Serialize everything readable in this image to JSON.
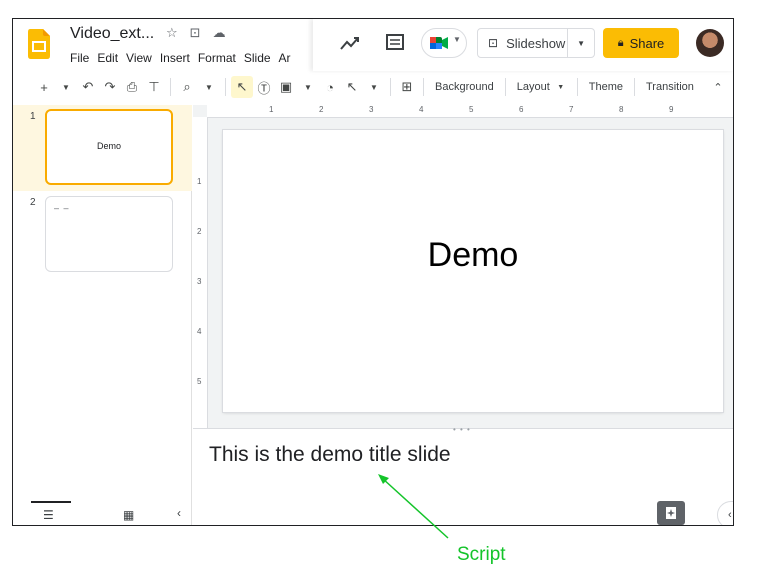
{
  "app": {
    "doc_title": "Video_ext...",
    "menu": [
      "File",
      "Edit",
      "View",
      "Insert",
      "Format",
      "Slide",
      "Ar"
    ]
  },
  "header": {
    "slideshow_label": "Slideshow",
    "share_label": "Share"
  },
  "toolbar": {
    "background_label": "Background",
    "layout_label": "Layout",
    "theme_label": "Theme",
    "transition_label": "Transition"
  },
  "filmstrip": {
    "slides": [
      {
        "number": "1",
        "title": "Demo",
        "selected": true
      },
      {
        "number": "2",
        "title": "",
        "selected": false
      }
    ]
  },
  "ruler": {
    "top_ticks": [
      "1",
      "2",
      "3",
      "4",
      "5",
      "6",
      "7",
      "8",
      "9"
    ],
    "left_ticks": [
      "1",
      "2",
      "3",
      "4",
      "5"
    ]
  },
  "slide": {
    "title": "Demo"
  },
  "notes": {
    "text": "This is the demo title slide"
  },
  "annotation": {
    "label": "Script",
    "color": "#14c42a"
  },
  "colors": {
    "accent": "#fbbc04",
    "selected_border": "#f9ab00"
  }
}
